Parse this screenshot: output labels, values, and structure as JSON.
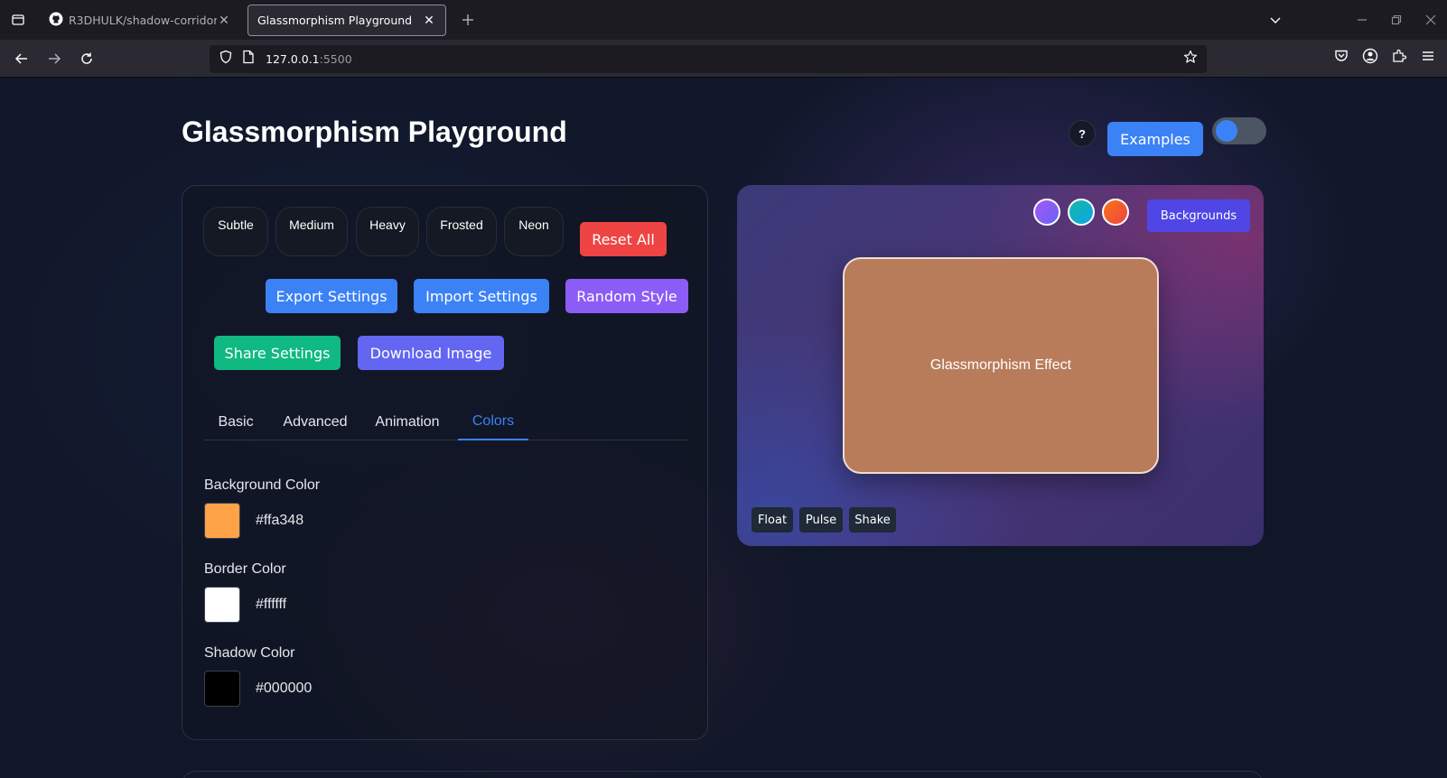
{
  "browser": {
    "tabs": [
      {
        "title": "R3DHULK/shadow-corridor",
        "icon": "github-icon",
        "active": false
      },
      {
        "title": "Glassmorphism Playground",
        "active": true
      }
    ],
    "url_host": "127.0.0.1",
    "url_port": ":5500"
  },
  "page": {
    "title": "Glassmorphism Playground",
    "help_label": "?",
    "examples_label": "Examples",
    "accent": "#3b82f6"
  },
  "presets": [
    "Subtle",
    "Medium",
    "Heavy",
    "Frosted",
    "Neon"
  ],
  "actions": {
    "reset": "Reset All",
    "export": "Export Settings",
    "import": "Import Settings",
    "random": "Random Style",
    "share": "Share Settings",
    "download": "Download Image"
  },
  "tabs": [
    {
      "label": "Basic",
      "active": false
    },
    {
      "label": "Advanced",
      "active": false
    },
    {
      "label": "Animation",
      "active": false
    },
    {
      "label": "Colors",
      "active": true
    }
  ],
  "colors": {
    "background": {
      "label": "Background Color",
      "value": "#ffa348"
    },
    "border": {
      "label": "Border Color",
      "value": "#ffffff"
    },
    "shadow": {
      "label": "Shadow Color",
      "value": "#000000"
    }
  },
  "preview": {
    "card_text": "Glassmorphism Effect",
    "backgrounds_label": "Backgrounds",
    "background_presets": [
      {
        "name": "purple-gradient",
        "colors": [
          "#a855f7",
          "#6366f1"
        ]
      },
      {
        "name": "teal-gradient",
        "colors": [
          "#14b8a6",
          "#0ea5e9"
        ]
      },
      {
        "name": "orange-gradient",
        "colors": [
          "#f97316",
          "#ef4444"
        ]
      }
    ],
    "animations": [
      "Float",
      "Pulse",
      "Shake"
    ]
  }
}
